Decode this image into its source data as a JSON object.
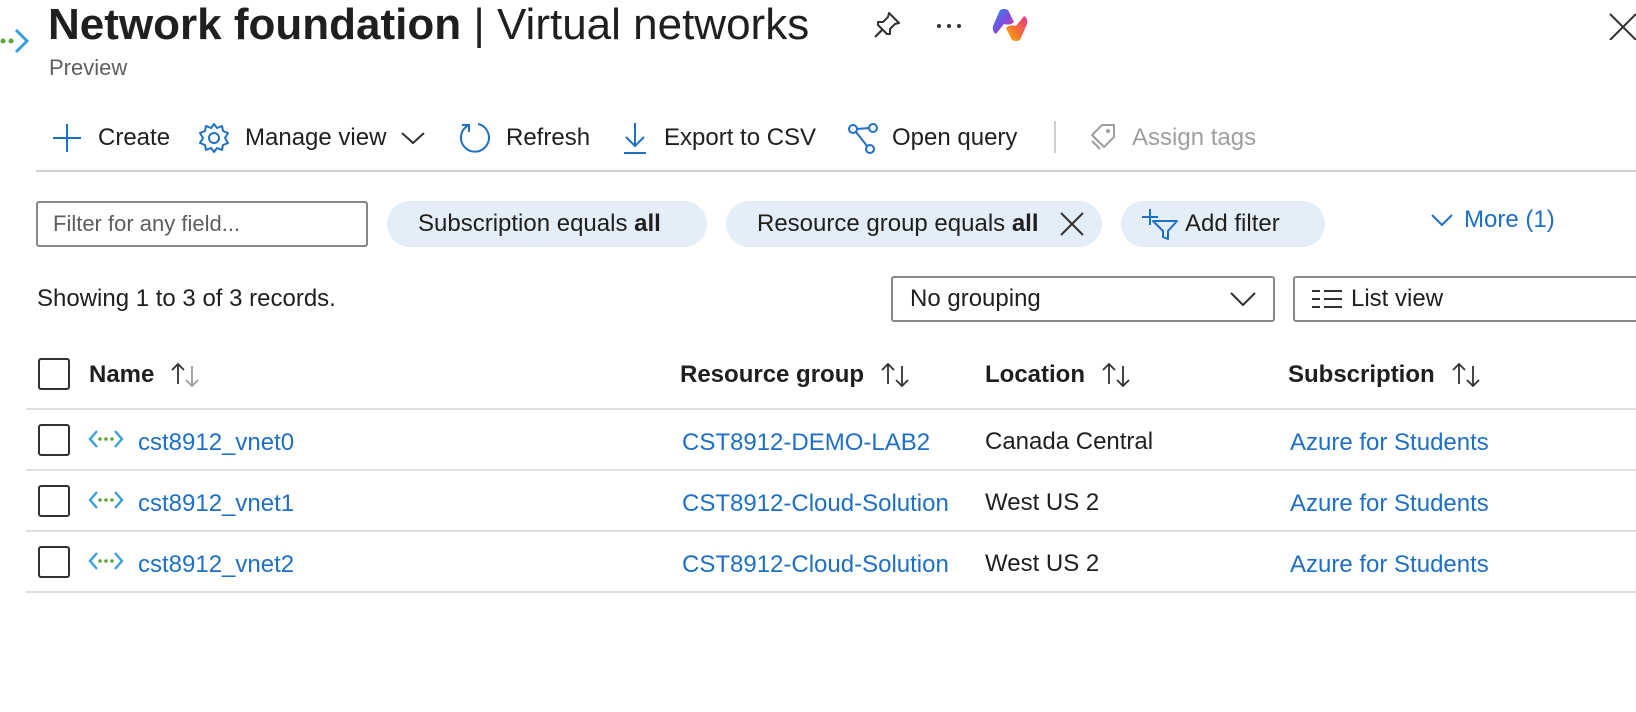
{
  "header": {
    "title_bold": "Network foundation",
    "title_sep": " | ",
    "title_rest": "Virtual networks",
    "subtitle": "Preview",
    "pin_icon": "pin-icon",
    "more_icon": "ellipsis-icon",
    "copilot_icon": "copilot-icon"
  },
  "toolbar": {
    "create": "Create",
    "manage_view": "Manage view",
    "refresh": "Refresh",
    "export_csv": "Export to CSV",
    "open_query": "Open query",
    "assign_tags": "Assign tags"
  },
  "filters": {
    "search_placeholder": "Filter for any field...",
    "subscription_label": "Subscription equals ",
    "subscription_value": "all",
    "resource_group_label": "Resource group equals ",
    "resource_group_value": "all",
    "add_filter": "Add filter",
    "more": "More (1)"
  },
  "records": {
    "summary": "Showing 1 to 3 of 3 records.",
    "grouping": "No grouping",
    "view": "List view"
  },
  "table": {
    "columns": {
      "name": "Name",
      "resource_group": "Resource group",
      "location": "Location",
      "subscription": "Subscription"
    },
    "rows": [
      {
        "name": "cst8912_vnet0",
        "resource_group": "CST8912-DEMO-LAB2",
        "location": "Canada Central",
        "subscription": "Azure for Students"
      },
      {
        "name": "cst8912_vnet1",
        "resource_group": "CST8912-Cloud-Solution",
        "location": "West US 2",
        "subscription": "Azure for Students"
      },
      {
        "name": "cst8912_vnet2",
        "resource_group": "CST8912-Cloud-Solution",
        "location": "West US 2",
        "subscription": "Azure for Students"
      }
    ]
  },
  "colors": {
    "link": "#1f6fc5",
    "pill_bg": "#e3eef9",
    "border": "#8a8886"
  }
}
